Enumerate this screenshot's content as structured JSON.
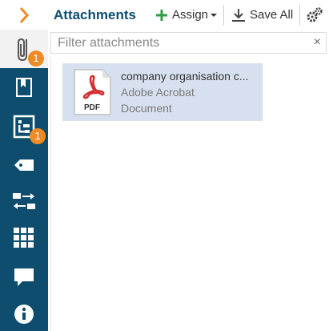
{
  "panel": {
    "title": "Attachments",
    "assign_label": "Assign",
    "save_all_label": "Save All"
  },
  "sidebar": {
    "attachments_badge": "1",
    "org_badge": "1"
  },
  "filter": {
    "placeholder": "Filter attachments",
    "clear": "×"
  },
  "attachments": [
    {
      "name": "company organisation c...",
      "type_line1": "Adobe Acrobat",
      "type_line2": "Document",
      "icon_label": "PDF"
    }
  ],
  "colors": {
    "sidebar": "#0e4d6e",
    "accent_orange": "#f08a24",
    "selection": "#d6e0ee",
    "pdf_red": "#d32f2f",
    "plus_green": "#2e9e44"
  }
}
